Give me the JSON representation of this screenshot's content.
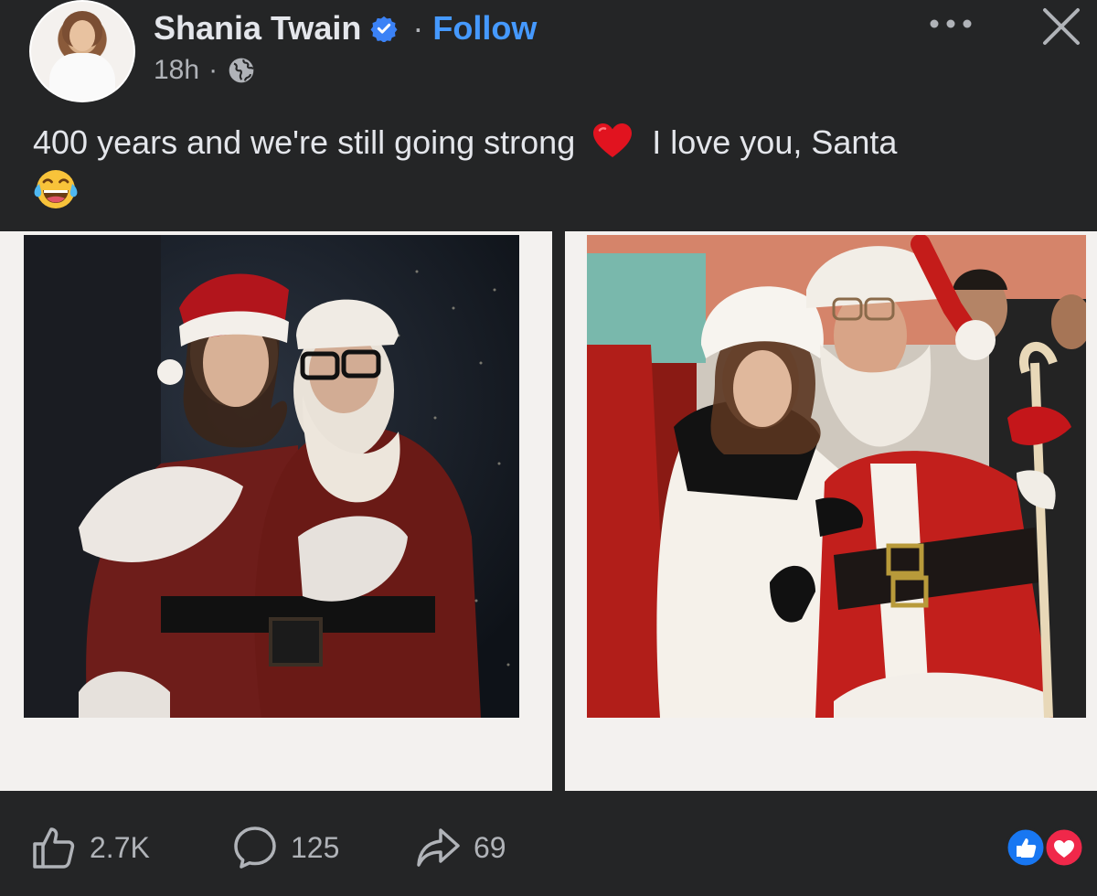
{
  "post": {
    "author": "Shania Twain",
    "separator": "·",
    "follow_label": "Follow",
    "time": "18h",
    "time_sep": "·",
    "caption_part1": "400 years and we're still going strong",
    "caption_part2": "I love you, Santa",
    "caption_emojis": [
      "red-heart",
      "face-with-tears-of-joy"
    ]
  },
  "engagement": {
    "likes": "2.7K",
    "comments": "125",
    "shares": "69",
    "reaction_types": [
      "like",
      "love"
    ]
  },
  "colors": {
    "background": "#242526",
    "text": "#e4e6eb",
    "muted": "#b0b3b8",
    "link": "#4599ff",
    "verified": "#3b82f6",
    "like_reaction": "#1877f2",
    "love_reaction": "#f0284a"
  },
  "icons": {
    "verified": "verified-badge-icon",
    "audience": "globe-icon",
    "more": "more-options-icon",
    "close": "close-icon",
    "like": "thumbs-up-icon",
    "comment": "comment-bubble-icon",
    "share": "share-arrow-icon"
  }
}
